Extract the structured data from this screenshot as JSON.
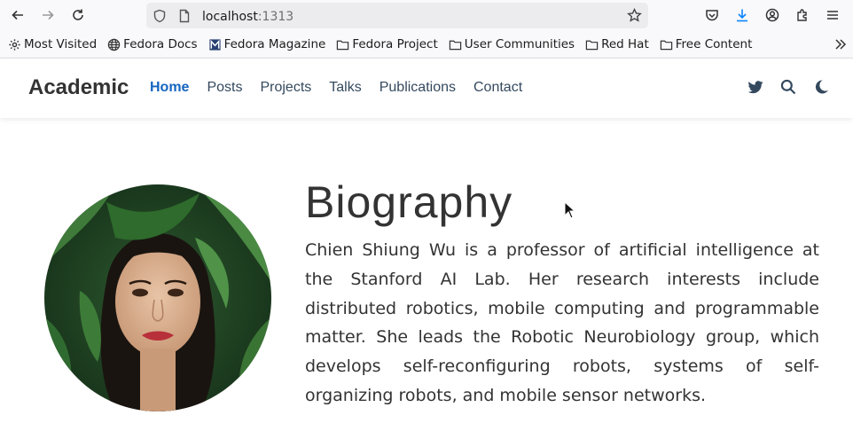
{
  "browser": {
    "url_host": "localhost",
    "url_port": ":1313",
    "nav_icons": [
      "back-icon",
      "forward-icon",
      "reload-icon"
    ],
    "toolbar_icons": [
      "pocket-icon",
      "download-icon",
      "account-icon",
      "extensions-icon",
      "menu-icon"
    ],
    "bookmarks": [
      {
        "label": "Most Visited",
        "icon": "gear-icon"
      },
      {
        "label": "Fedora Docs",
        "icon": "globe-icon"
      },
      {
        "label": "Fedora Magazine",
        "icon": "magazine-icon"
      },
      {
        "label": "Fedora Project",
        "icon": "folder-icon"
      },
      {
        "label": "User Communities",
        "icon": "folder-icon"
      },
      {
        "label": "Red Hat",
        "icon": "folder-icon"
      },
      {
        "label": "Free Content",
        "icon": "folder-icon"
      }
    ]
  },
  "site": {
    "brand": "Academic",
    "nav": [
      {
        "label": "Home",
        "active": true
      },
      {
        "label": "Posts"
      },
      {
        "label": "Projects"
      },
      {
        "label": "Talks"
      },
      {
        "label": "Publications"
      },
      {
        "label": "Contact"
      }
    ],
    "nav_icons": [
      "twitter-icon",
      "search-icon",
      "dark-mode-icon"
    ],
    "accent_color": "#1565c0"
  },
  "bio": {
    "title": "Biography",
    "text": "Chien Shiung Wu is a professor of artificial intelligence at the Stanford AI Lab. Her research interests include distributed robotics, mobile computing and programmable matter. She leads the Robotic Neurobiology group, which develops self-reconfiguring robots, systems of self-organizing robots, and mobile sensor networks."
  }
}
